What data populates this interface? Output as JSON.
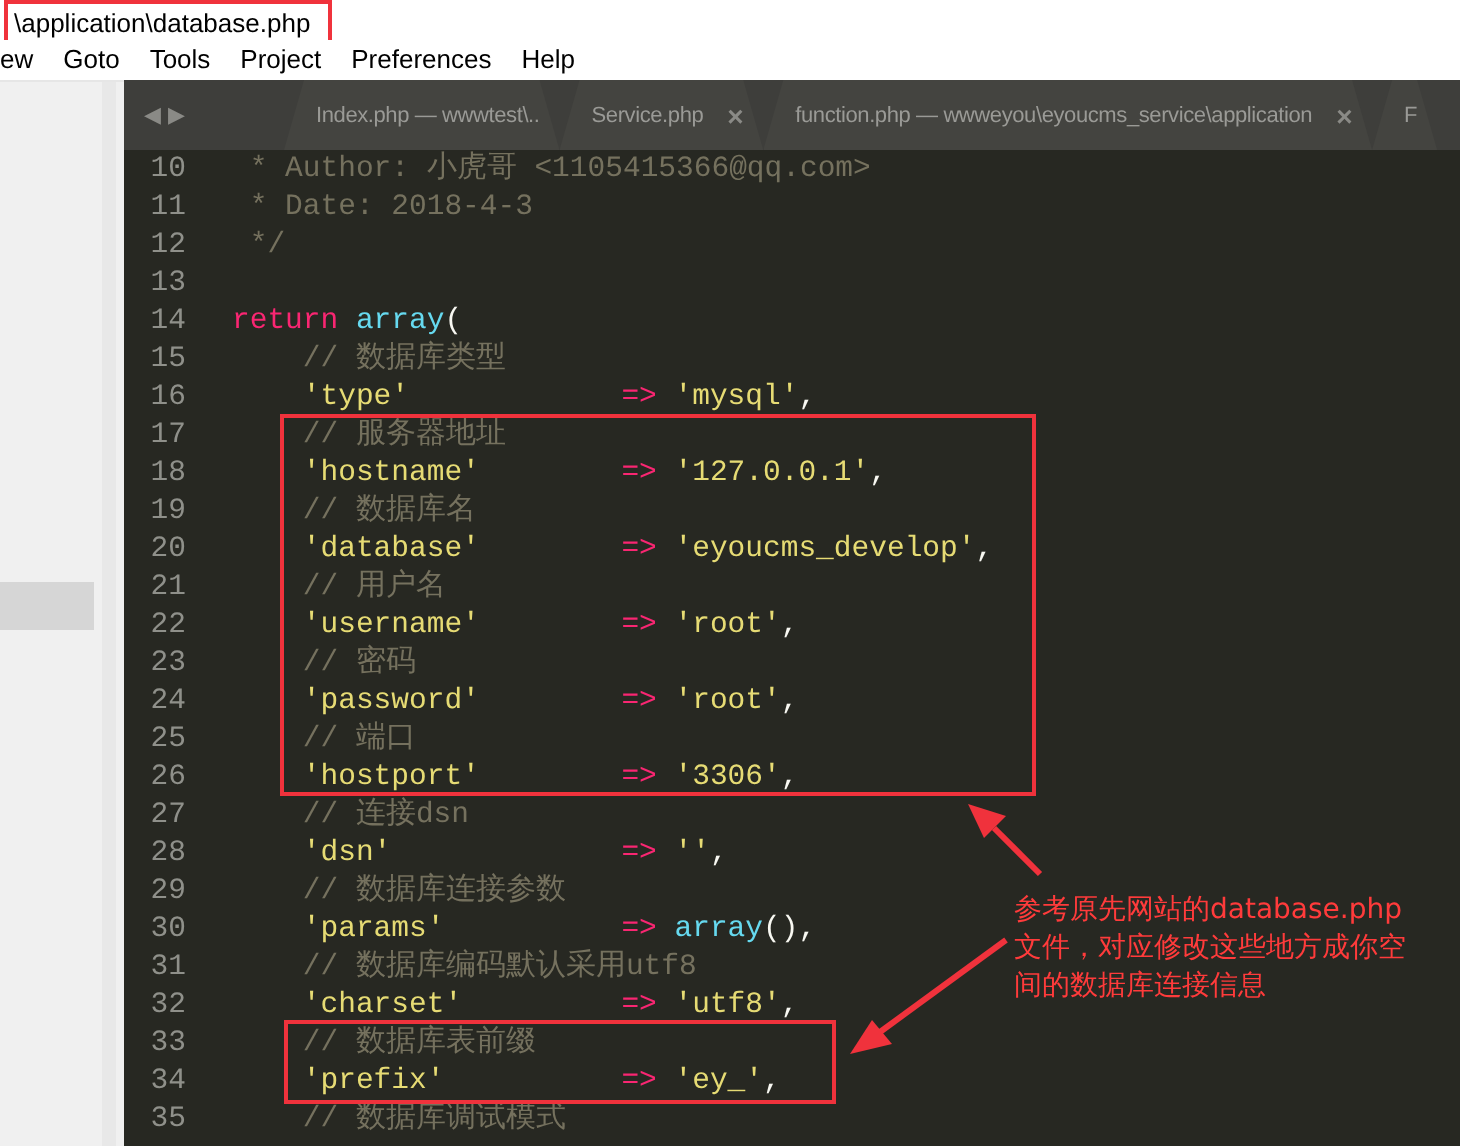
{
  "window": {
    "title": "\\application\\database.php"
  },
  "menu": [
    "ew",
    "Goto",
    "Tools",
    "Project",
    "Preferences",
    "Help"
  ],
  "tabs": [
    {
      "label": "Index.php — wwwtest\\..",
      "selected": false
    },
    {
      "label": "Service.php",
      "selected": false,
      "close": "×"
    },
    {
      "label": "function.php — wwweyou\\eyoucms_service\\application",
      "selected": false,
      "close": "×"
    },
    {
      "label": "F",
      "selected": false
    }
  ],
  "tab_arrows": [
    "◀",
    "▶"
  ],
  "code": [
    {
      "number": "10",
      "kind": "doc",
      "tokens": [
        {
          "kind": "comment",
          "text": "* Author: 小虎哥 <1105415366@qq.com>"
        }
      ]
    },
    {
      "number": "11",
      "kind": "doc",
      "tokens": [
        {
          "kind": "comment",
          "text": "* Date: 2018-4-3"
        }
      ]
    },
    {
      "number": "12",
      "kind": "doc",
      "tokens": [
        {
          "kind": "comment",
          "text": "*/"
        }
      ]
    },
    {
      "number": "13",
      "kind": "blank"
    },
    {
      "number": "14",
      "kind": "code",
      "tokens": [
        {
          "kind": "keyword",
          "text": "return"
        },
        {
          "kind": "func",
          "text": "array"
        },
        {
          "kind": "punct",
          "text": "("
        }
      ]
    },
    {
      "number": "15",
      "kind": "comment",
      "tokens": [
        {
          "kind": "comment",
          "text": "// 数据库类型"
        }
      ]
    },
    {
      "number": "16",
      "kind": "entry",
      "tokens": [
        {
          "kind": "string",
          "text": "'type'"
        },
        {
          "kind": "operator",
          "text": "=>"
        },
        {
          "kind": "string",
          "text": "'mysql'"
        },
        {
          "kind": "punct",
          "text": ","
        }
      ]
    },
    {
      "number": "17",
      "kind": "comment",
      "tokens": [
        {
          "kind": "comment",
          "text": "// 服务器地址"
        }
      ]
    },
    {
      "number": "18",
      "kind": "entry",
      "tokens": [
        {
          "kind": "string",
          "text": "'hostname'"
        },
        {
          "kind": "operator",
          "text": "=>"
        },
        {
          "kind": "string",
          "text": "'127.0.0.1'"
        },
        {
          "kind": "punct",
          "text": ","
        }
      ]
    },
    {
      "number": "19",
      "kind": "comment",
      "tokens": [
        {
          "kind": "comment",
          "text": "// 数据库名"
        }
      ]
    },
    {
      "number": "20",
      "kind": "entry",
      "tokens": [
        {
          "kind": "string",
          "text": "'database'"
        },
        {
          "kind": "operator",
          "text": "=>"
        },
        {
          "kind": "string",
          "text": "'eyoucms_develop'"
        },
        {
          "kind": "punct",
          "text": ","
        }
      ]
    },
    {
      "number": "21",
      "kind": "comment",
      "tokens": [
        {
          "kind": "comment",
          "text": "// 用户名"
        }
      ]
    },
    {
      "number": "22",
      "kind": "entry",
      "tokens": [
        {
          "kind": "string",
          "text": "'username'"
        },
        {
          "kind": "operator",
          "text": "=>"
        },
        {
          "kind": "string",
          "text": "'root'"
        },
        {
          "kind": "punct",
          "text": ","
        }
      ]
    },
    {
      "number": "23",
      "kind": "comment",
      "tokens": [
        {
          "kind": "comment",
          "text": "// 密码"
        }
      ]
    },
    {
      "number": "24",
      "kind": "entry",
      "tokens": [
        {
          "kind": "string",
          "text": "'password'"
        },
        {
          "kind": "operator",
          "text": "=>"
        },
        {
          "kind": "string",
          "text": "'root'"
        },
        {
          "kind": "punct",
          "text": ","
        }
      ]
    },
    {
      "number": "25",
      "kind": "comment",
      "tokens": [
        {
          "kind": "comment",
          "text": "// 端口"
        }
      ]
    },
    {
      "number": "26",
      "kind": "entry",
      "tokens": [
        {
          "kind": "string",
          "text": "'hostport'"
        },
        {
          "kind": "operator",
          "text": "=>"
        },
        {
          "kind": "string",
          "text": "'3306'"
        },
        {
          "kind": "punct",
          "text": ","
        }
      ]
    },
    {
      "number": "27",
      "kind": "comment",
      "tokens": [
        {
          "kind": "comment",
          "text": "// 连接dsn"
        }
      ]
    },
    {
      "number": "28",
      "kind": "entry",
      "tokens": [
        {
          "kind": "string",
          "text": "'dsn'"
        },
        {
          "kind": "operator",
          "text": "=>"
        },
        {
          "kind": "string",
          "text": "''"
        },
        {
          "kind": "punct",
          "text": ","
        }
      ]
    },
    {
      "number": "29",
      "kind": "comment",
      "tokens": [
        {
          "kind": "comment",
          "text": "// 数据库连接参数"
        }
      ]
    },
    {
      "number": "30",
      "kind": "entry",
      "tokens": [
        {
          "kind": "string",
          "text": "'params'"
        },
        {
          "kind": "operator",
          "text": "=>"
        },
        {
          "kind": "func",
          "text": "array"
        },
        {
          "kind": "punct",
          "text": "(),"
        }
      ]
    },
    {
      "number": "31",
      "kind": "comment",
      "tokens": [
        {
          "kind": "comment",
          "text": "// 数据库编码默认采用utf8"
        }
      ]
    },
    {
      "number": "32",
      "kind": "entry",
      "tokens": [
        {
          "kind": "string",
          "text": "'charset'"
        },
        {
          "kind": "operator",
          "text": "=>"
        },
        {
          "kind": "string",
          "text": "'utf8'"
        },
        {
          "kind": "punct",
          "text": ","
        }
      ]
    },
    {
      "number": "33",
      "kind": "comment",
      "tokens": [
        {
          "kind": "comment",
          "text": "// 数据库表前缀"
        }
      ]
    },
    {
      "number": "34",
      "kind": "entry",
      "tokens": [
        {
          "kind": "string",
          "text": "'prefix'"
        },
        {
          "kind": "operator",
          "text": "=>"
        },
        {
          "kind": "string",
          "text": "'ey_'"
        },
        {
          "kind": "punct",
          "text": ","
        }
      ]
    },
    {
      "number": "35",
      "kind": "comment",
      "tokens": [
        {
          "kind": "comment",
          "text": "// 数据库调试模式"
        }
      ]
    }
  ],
  "annotation": {
    "note": "参考原先网站的database.php文件，对应修改这些地方成你空间的数据库连接信息"
  }
}
